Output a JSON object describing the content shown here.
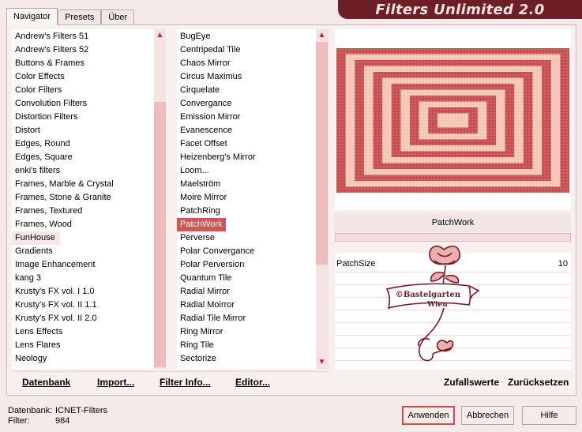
{
  "tabs": [
    {
      "label": "Navigator",
      "active": true
    },
    {
      "label": "Presets",
      "active": false
    },
    {
      "label": "Über",
      "active": false
    }
  ],
  "app_title": "Filters Unlimited 2.0",
  "categories": {
    "items": [
      "Andrew's Filters 51",
      "Andrew's Filters 52",
      "Buttons & Frames",
      "Color Effects",
      "Color Filters",
      "Convolution Filters",
      "Distortion Filters",
      "Distort",
      "Edges, Round",
      "Edges, Square",
      "enki's filters",
      "Frames, Marble & Crystal",
      "Frames, Stone & Granite",
      "Frames, Textured",
      "Frames, Wood",
      "FunHouse",
      "Gradients",
      "Image Enhancement",
      "kang 3",
      "Krusty's FX vol. I 1.0",
      "Krusty's FX vol. II 1.1",
      "Krusty's FX vol. II 2.0",
      "Lens Effects",
      "Lens Flares",
      "Neology"
    ],
    "selected": "FunHouse"
  },
  "filters": {
    "items": [
      "BugEye",
      "Centripedal Tile",
      "Chaos Mirror",
      "Circus Maximus",
      "Cirquelate",
      "Convergance",
      "Emission Mirror",
      "Evanescence",
      "Facet Offset",
      "Heizenberg's Mirror",
      "Loom...",
      "Maelström",
      "Moire Mirror",
      "PatchRing",
      "PatchWork",
      "Perverse",
      "Polar Convergance",
      "Polar Perversion",
      "Quantum Tile",
      "Radial Mirror",
      "Radial Moirror",
      "Radial Tile Mirror",
      "Ring Mirror",
      "Ring Tile",
      "Sectorize"
    ],
    "selected": "PatchWork"
  },
  "preview": {
    "filter_name": "PatchWork",
    "param_label": "PatchSize",
    "param_value": "10",
    "watermark_line1": "©Bastelgarten",
    "watermark_line2": "Wien"
  },
  "bottom_links": {
    "datenbank": "Datenbank",
    "import": "Import...",
    "filter_info": "Filter Info...",
    "editor": "Editor...",
    "zufallswerte": "Zufallswerte",
    "zuruecksetzen": "Zurücksetzen"
  },
  "status": {
    "db_label": "Datenbank:",
    "db_value": "ICNET-Filters",
    "filter_label": "Filter:",
    "filter_value": "984"
  },
  "buttons": {
    "apply": "Anwenden",
    "cancel": "Abbrechen",
    "help": "Hilfe"
  },
  "colors": {
    "accent": "#c8202a",
    "title_bg": "#6e1f25",
    "selection": "#d05555",
    "highlight": "#f7e8e8",
    "patch_light": "#f5c6b4",
    "patch_dark": "#c84f4f"
  }
}
